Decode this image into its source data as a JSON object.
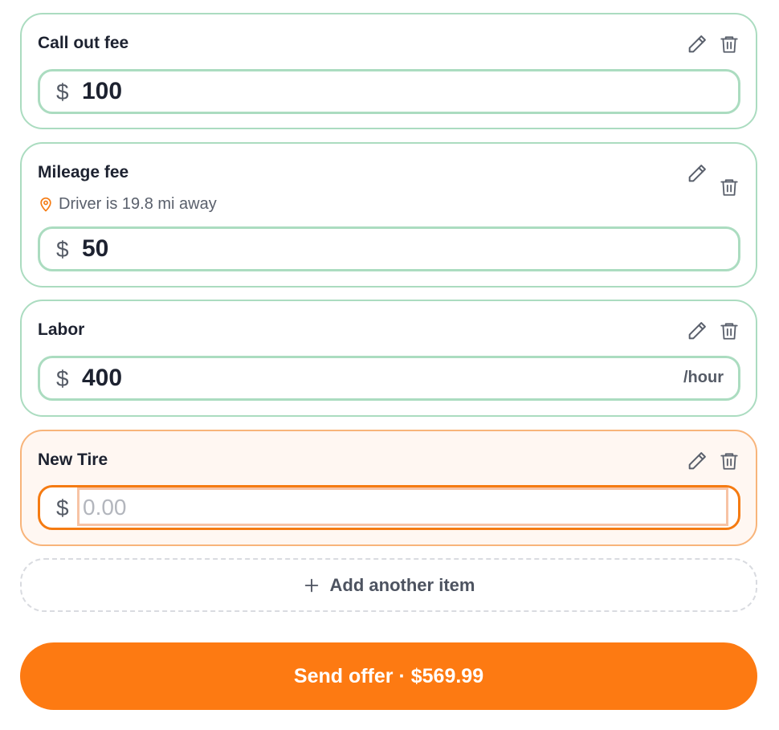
{
  "items": [
    {
      "title": "Call out fee",
      "currency": "$",
      "amount": "100",
      "edit_icon": "pencil-icon",
      "delete_icon": "trash-icon"
    },
    {
      "title": "Mileage fee",
      "subtitle": "Driver is 19.8 mi away",
      "subtitle_icon": "map-pin-icon",
      "currency": "$",
      "amount": "50",
      "edit_icon": "pencil-icon",
      "delete_icon": "trash-icon"
    },
    {
      "title": "Labor",
      "currency": "$",
      "amount": "400",
      "suffix": "/hour",
      "edit_icon": "pencil-icon",
      "delete_icon": "trash-icon"
    },
    {
      "title": "New Tire",
      "currency": "$",
      "placeholder": "0.00",
      "value": "",
      "edit_icon": "pencil-icon",
      "delete_icon": "trash-icon"
    }
  ],
  "add_item": {
    "label": "Add another item",
    "icon": "plus-icon"
  },
  "send_offer": {
    "label": "Send offer · $569.99"
  },
  "colors": {
    "accent": "#fd7a12",
    "card_border": "#abdcc0",
    "active_border": "#f8b47a",
    "active_bg": "#fff7f2"
  }
}
